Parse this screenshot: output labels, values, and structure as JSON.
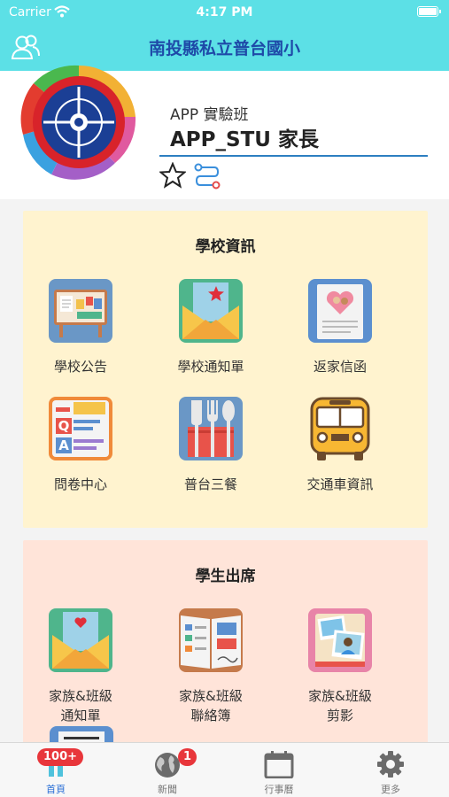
{
  "status": {
    "carrier": "Carrier",
    "time": "4:17 PM"
  },
  "nav": {
    "title": "南投縣私立普台國小"
  },
  "profile": {
    "class_name": "APP 實驗班",
    "user_name": "APP_STU 家長"
  },
  "school_info": {
    "title": "學校資訊",
    "items": [
      {
        "label": "學校公告",
        "icon": "bulletin-board-icon"
      },
      {
        "label": "學校通知單",
        "icon": "envelope-star-icon"
      },
      {
        "label": "返家信函",
        "icon": "heart-letter-icon"
      },
      {
        "label": "問卷中心",
        "icon": "questionnaire-icon"
      },
      {
        "label": "普台三餐",
        "icon": "cutlery-icon"
      },
      {
        "label": "交通車資訊",
        "icon": "bus-icon"
      }
    ]
  },
  "attendance": {
    "title": "學生出席",
    "items": [
      {
        "label_line1": "家族&班級",
        "label_line2": "通知單",
        "icon": "envelope-heart-icon"
      },
      {
        "label_line1": "家族&班級",
        "label_line2": "聯絡簿",
        "icon": "contact-book-icon"
      },
      {
        "label_line1": "家族&班級",
        "label_line2": "剪影",
        "icon": "photo-album-icon"
      }
    ]
  },
  "tabbar": {
    "items": [
      {
        "label": "首頁",
        "badge": "100+",
        "icon": "home-icon",
        "active": true
      },
      {
        "label": "新聞",
        "badge": "1",
        "icon": "globe-icon",
        "active": false
      },
      {
        "label": "行事曆",
        "badge": "",
        "icon": "calendar-icon",
        "active": false
      },
      {
        "label": "更多",
        "badge": "",
        "icon": "gear-icon",
        "active": false
      }
    ]
  },
  "colors": {
    "nav": "#5ce0e6",
    "title": "#1e4aa8",
    "school_panel": "#fff3cf",
    "attendance_panel": "#ffe4d9",
    "accent": "#2a6fd6"
  }
}
